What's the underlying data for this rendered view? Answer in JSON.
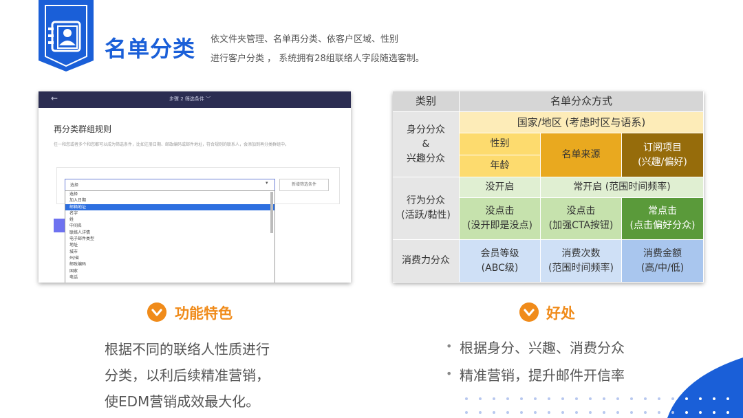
{
  "header": {
    "title": "名单分类",
    "desc_line1": "依文件夹管理、名单再分类、依客户区域、性别",
    "desc_line2": "进行客户分类 ， 系统拥有28组联络人字段随选客制。",
    "accent": "#1a5fd8"
  },
  "screenshot": {
    "back_icon": "←",
    "step_label": "步骤 2  筛选条件  ﹀",
    "rule_title": "再分类群组规则",
    "hint": "任一和您或者多个和您都可以成为筛选条件，比如注册日期、邮政编码或邮件地址，符合规则的联系人，会添加到再分类群组中。",
    "select_value": "选择",
    "add_button": "新增筛选条件",
    "options": [
      "选择",
      "加入日期",
      "邮箱地址",
      "名字",
      "姓",
      "中间名",
      "联络人详情",
      "电子邮件类型",
      "地址",
      "城市",
      "州/省",
      "邮政编码",
      "国家",
      "电话"
    ],
    "selected_option": "邮箱地址"
  },
  "table": {
    "header": {
      "col1": "类别",
      "col2": "名单分众方式"
    },
    "row1_label": "身分分众\n&\n兴趣分众",
    "country": "国家/地区 (考虑时区与语系)",
    "gender": "性别",
    "age": "年龄",
    "source": "名单来源",
    "subscribe": "订阅项目\n(兴趣/偏好)",
    "row2_label": "行为分众\n(活跃/黏性)",
    "not_open": "没开启",
    "often_open": "常开启 (范围时间频率)",
    "no_click_a": "没点击\n(没开即是没点)",
    "no_click_b": "没点击\n(加强CTA按钮)",
    "often_click": "常点击\n(点击偏好分众)",
    "row3_label": "消费力分众",
    "member": "会员等级\n(ABC级)",
    "count": "消费次数\n(范围时间频率)",
    "amount": "消费金额\n(高/中/低)",
    "colors": {
      "header": "#d6d6d6",
      "label": "#e6e6e6",
      "cream": "#fdecb8",
      "yellow": "#fddb6e",
      "gold": "#e9a91f",
      "brown": "#966c0b",
      "light_green": "#e0efd2",
      "green": "#c6e2ad",
      "dark_green": "#5a9a3a",
      "light_blue": "#cfe0f6",
      "blue": "#a9c6ee"
    }
  },
  "features": {
    "title": "功能特色",
    "lines": [
      "根据不同的联络人性质进行",
      "分类，以利后续精准营销，",
      "使EDM营销成效最大化。"
    ]
  },
  "benefits": {
    "title": "好处",
    "bullet": "•",
    "lines": [
      "根据身分、兴趣、消费分众",
      "精准营销，提升邮件开信率"
    ]
  },
  "icons": {
    "header_icon": "contact-card-icon",
    "badge_icon": "chevron-down-icon"
  }
}
